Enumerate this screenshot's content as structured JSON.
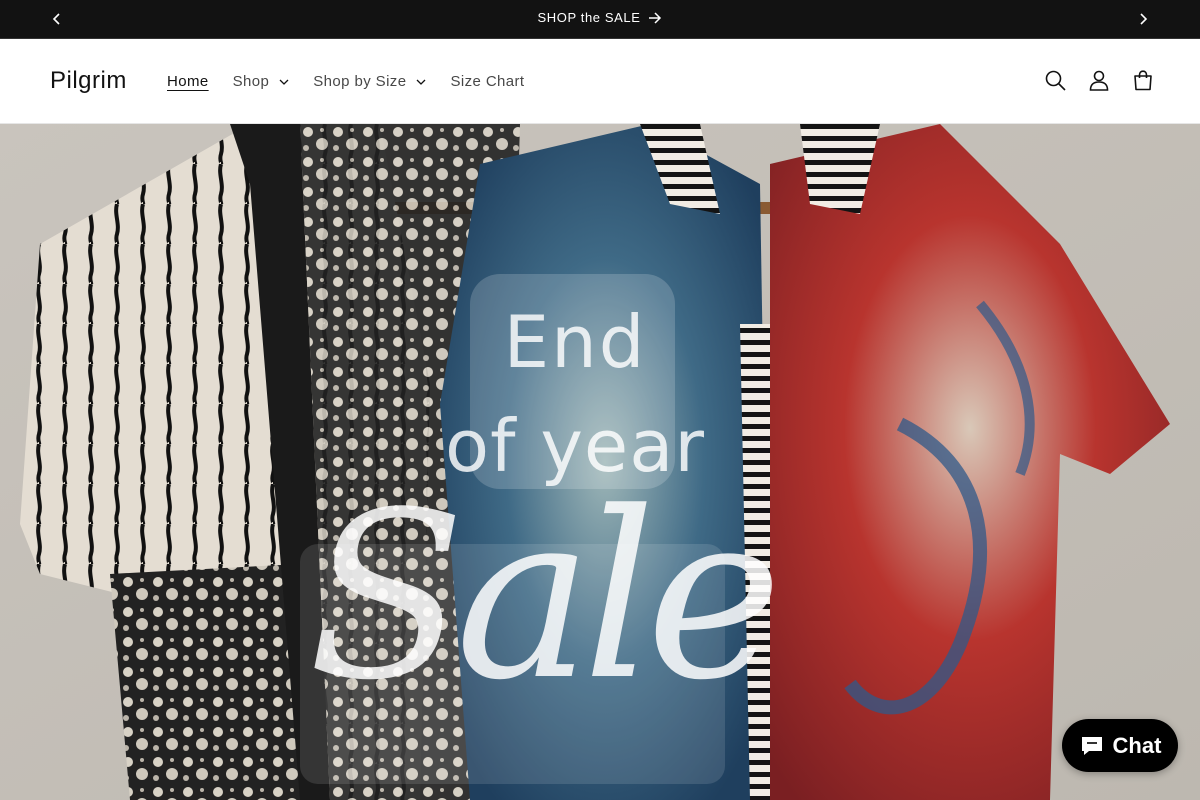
{
  "announcement": {
    "text": "SHOP the SALE",
    "prev_icon": "chevron-left-icon",
    "next_icon": "chevron-right-icon",
    "arrow_icon": "arrow-right-icon"
  },
  "header": {
    "logo": "Pilgrim",
    "nav": [
      {
        "label": "Home",
        "active": true,
        "dropdown": false
      },
      {
        "label": "Shop",
        "active": false,
        "dropdown": true
      },
      {
        "label": "Shop by Size",
        "active": false,
        "dropdown": true
      },
      {
        "label": "Size Chart",
        "active": false,
        "dropdown": false
      }
    ],
    "icons": [
      "search-icon",
      "account-icon",
      "cart-icon"
    ]
  },
  "hero": {
    "line1": "End",
    "line2": "of year",
    "script": "Sale"
  },
  "chat": {
    "label": "Chat",
    "icon": "chat-bubble-icon",
    "color": "#000000"
  },
  "colors": {
    "announcement_bg": "#121212",
    "text": "#121212"
  }
}
